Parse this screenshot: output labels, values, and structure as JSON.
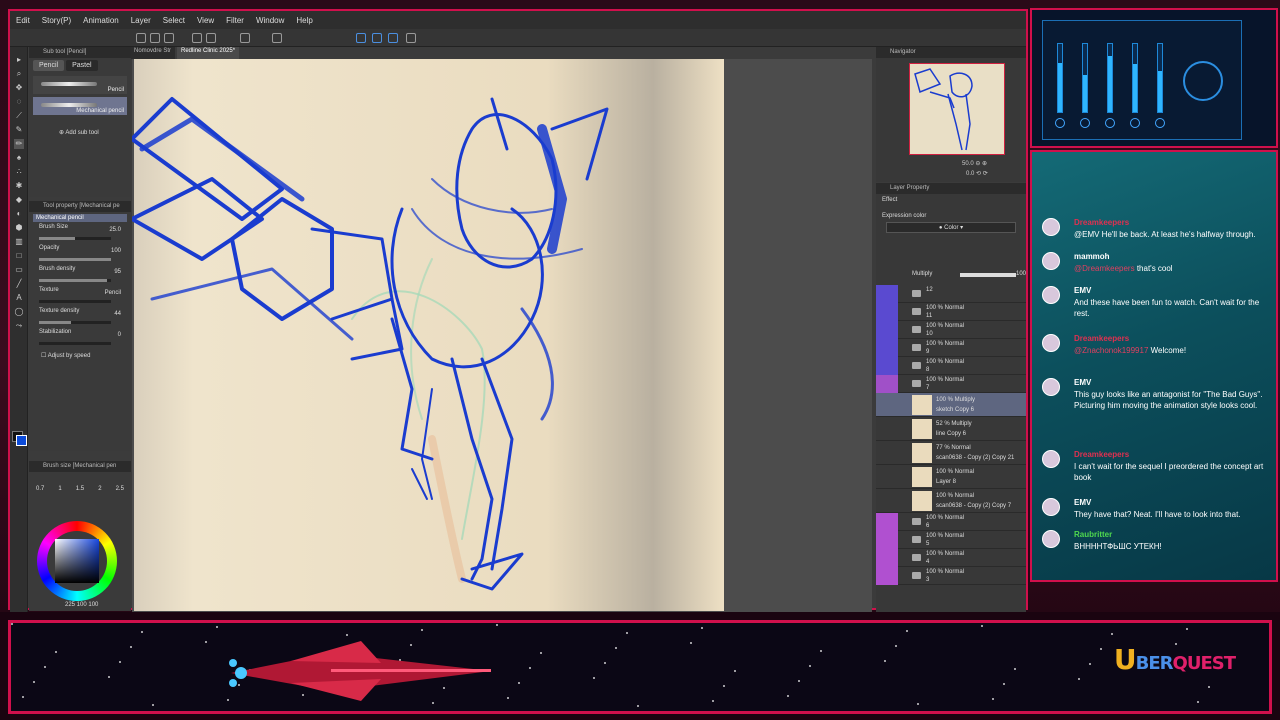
{
  "menu": [
    "Edit",
    "Story(P)",
    "Animation",
    "Layer",
    "Select",
    "View",
    "Filter",
    "Window",
    "Help"
  ],
  "doc_tabs": [
    "Nomovdre Str",
    "Redline Clinic 2025*"
  ],
  "subtool": {
    "header": "Sub tool [Pencil]",
    "tabs": [
      "Pencil",
      "Pastel"
    ],
    "brushes": [
      "Pencil",
      "Mechanical pencil"
    ],
    "add_label": "Add sub tool"
  },
  "toolprop": {
    "header": "Tool property [Mechanical pe",
    "selected": "Mechanical pencil",
    "props": [
      {
        "label": "Brush Size",
        "value": "25.0",
        "fraction": 0.5
      },
      {
        "label": "Opacity",
        "value": "100",
        "fraction": 1.0
      },
      {
        "label": "Brush density",
        "value": "95",
        "fraction": 0.95
      },
      {
        "label": "Texture",
        "value": "Pencil",
        "fraction": 0
      },
      {
        "label": "Texture density",
        "value": "44",
        "fraction": 0.44
      },
      {
        "label": "Stabilization",
        "value": "0",
        "fraction": 0
      }
    ],
    "adjust_label": "Adjust by speed"
  },
  "brushsize": {
    "header": "Brush size [Mechanical pen",
    "sizes": [
      "0.7",
      "1",
      "1.5",
      "2",
      "2.5"
    ],
    "hsv": "225 100 100"
  },
  "navigator": {
    "header": "Navigator",
    "zoom": "50.0",
    "rotation": "0.0"
  },
  "layerprop": {
    "header": "Layer Property",
    "effect_label": "Effect",
    "expression_label": "Expression color",
    "expression_value": "Color"
  },
  "layers": {
    "blend_mode": "Multiply",
    "opacity": "100",
    "rows": [
      {
        "l1": "12",
        "l2": "",
        "kind": "folder",
        "color": "#5a4ad0"
      },
      {
        "l1": "100 % Normal",
        "l2": "11",
        "kind": "folder",
        "color": "#5a4ad0"
      },
      {
        "l1": "100 % Normal",
        "l2": "10",
        "kind": "folder",
        "color": "#5a4ad0"
      },
      {
        "l1": "100 % Normal",
        "l2": "9",
        "kind": "folder",
        "color": "#5a4ad0"
      },
      {
        "l1": "100 % Normal",
        "l2": "8",
        "kind": "folder",
        "color": "#5a4ad0"
      },
      {
        "l1": "100 % Normal",
        "l2": "7",
        "kind": "folder",
        "color": "#a050c8"
      },
      {
        "l1": "100 % Multiply",
        "l2": "sketch Copy 6",
        "kind": "layer",
        "selected": true
      },
      {
        "l1": "52 % Multiply",
        "l2": "line Copy 6",
        "kind": "layer"
      },
      {
        "l1": "77 % Normal",
        "l2": "scan0638 - Copy (2) Copy 21",
        "kind": "layer"
      },
      {
        "l1": "100 % Normal",
        "l2": "Layer 8",
        "kind": "layer"
      },
      {
        "l1": "100 % Normal",
        "l2": "scan0638 - Copy (2) Copy 7",
        "kind": "layer"
      },
      {
        "l1": "100 % Normal",
        "l2": "6",
        "kind": "folder",
        "color": "#b050d0"
      },
      {
        "l1": "100 % Normal",
        "l2": "5",
        "kind": "folder",
        "color": "#b050d0"
      },
      {
        "l1": "100 % Normal",
        "l2": "4",
        "kind": "folder",
        "color": "#b050d0"
      },
      {
        "l1": "100 % Normal",
        "l2": "3",
        "kind": "folder",
        "color": "#b050d0"
      }
    ]
  },
  "chat": [
    {
      "name": "Dreamkeepers",
      "color": "red",
      "body": "@EMV He'll be back. At least he's halfway through."
    },
    {
      "name": "mammoh",
      "color": "white",
      "mention": "@Dreamkeepers",
      "body": " that's cool"
    },
    {
      "name": "EMV",
      "color": "white",
      "body": "And these have been fun to watch. Can't wait for the rest."
    },
    {
      "name": "Dreamkeepers",
      "color": "red",
      "mention": "@Znachonok199917",
      "body": " Welcome!"
    },
    {
      "name": "EMV",
      "color": "white",
      "body": "This guy looks like an antagonist for \"The Bad Guys\". Picturing him moving the animation style looks cool."
    },
    {
      "name": "Dreamkeepers",
      "color": "red",
      "body": "I can't wait for the sequel I preordered the concept art book"
    },
    {
      "name": "EMV",
      "color": "white",
      "body": "They have that? Neat. I'll have to look into that."
    },
    {
      "name": "Raubritter",
      "color": "green",
      "body": "ВННННТФЬШС УТЕКН!"
    }
  ],
  "mixer_levels": [
    0.72,
    0.55,
    0.82,
    0.7,
    0.6
  ],
  "logo": {
    "u": "U",
    "rest": "BER",
    "q": "QUEST"
  }
}
